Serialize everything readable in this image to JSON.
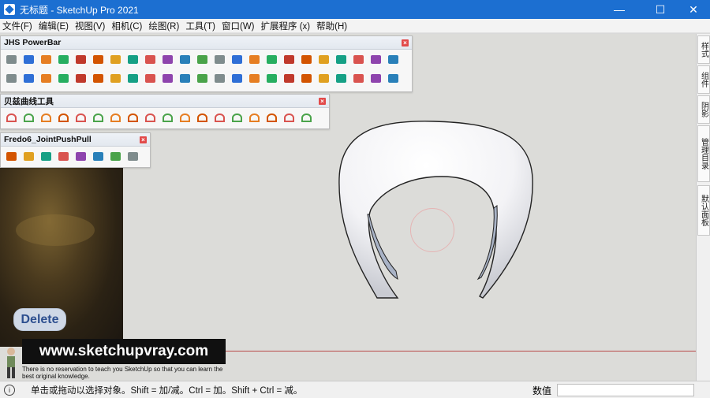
{
  "window": {
    "title": "无标题 - SketchUp Pro 2021",
    "minimize": "—",
    "maximize": "☐",
    "close": "✕"
  },
  "menu": [
    "文件(F)",
    "编辑(E)",
    "视图(V)",
    "相机(C)",
    "绘图(R)",
    "工具(T)",
    "窗口(W)",
    "扩展程序 (x)",
    "帮助(H)"
  ],
  "toolbars": {
    "jhs": {
      "title": "JHS PowerBar",
      "row1_count": 23,
      "row2_count": 23
    },
    "bezier": {
      "title": "贝兹曲线工具",
      "count": 18
    },
    "fredo": {
      "title": "Fredo6_JointPushPull",
      "count": 8
    }
  },
  "right_tabs": [
    "样式",
    "组件",
    "阴影",
    "管理目录",
    "默认面板"
  ],
  "overlay": {
    "delete_label": "Delete",
    "site": "www.sketchupvray.com",
    "note": "There is no reservation to teach you SketchUp so that you can learn the best original knowledge."
  },
  "status": {
    "info_icon": "i",
    "hint": "单击或拖动以选择对象。Shift = 加/减。Ctrl = 加。Shift + Ctrl = 减。",
    "measure_label": "数值",
    "measure_value": ""
  }
}
